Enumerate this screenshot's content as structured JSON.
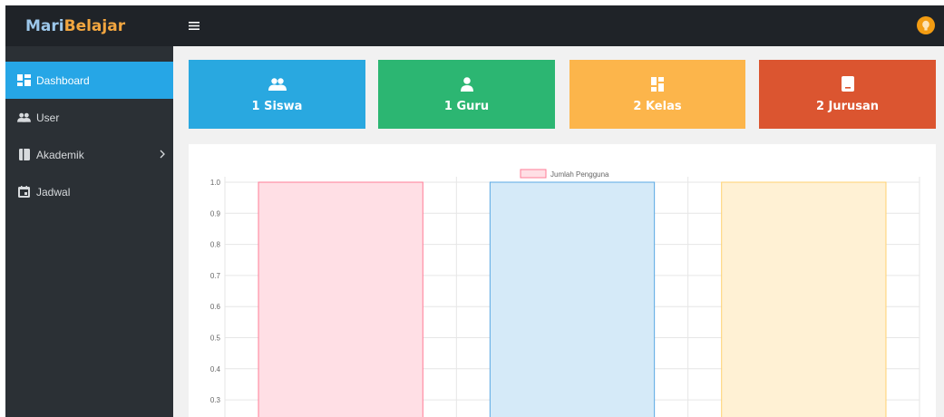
{
  "brand": {
    "part1": "Mari",
    "part2": "Belajar"
  },
  "sidebar": {
    "items": [
      {
        "label": "Dashboard",
        "icon": "dashboard-icon",
        "active": true
      },
      {
        "label": "User",
        "icon": "users-icon"
      },
      {
        "label": "Akademik",
        "icon": "book-icon",
        "has_submenu": true
      },
      {
        "label": "Jadwal",
        "icon": "calendar-icon"
      }
    ]
  },
  "topbar": {
    "menu_icon": "hamburger-icon",
    "avatar_icon": "user-avatar-icon"
  },
  "stats": [
    {
      "label": "1 Siswa",
      "icon": "users-icon",
      "color": "#29a8e0"
    },
    {
      "label": "1 Guru",
      "icon": "user-icon",
      "color": "#2cb672"
    },
    {
      "label": "2 Kelas",
      "icon": "dashboard-icon",
      "color": "#fcb54b"
    },
    {
      "label": "2 Jurusan",
      "icon": "book-icon",
      "color": "#db5530"
    }
  ],
  "chart_data": {
    "type": "bar",
    "legend": "Jumlah Pengguna",
    "legend_placement": "top-center",
    "categories": [
      "",
      "",
      ""
    ],
    "values": [
      1.0,
      1.0,
      1.0
    ],
    "colors": [
      {
        "fill": "#ffdfe5",
        "stroke": "#ff7c97"
      },
      {
        "fill": "#d5eaf8",
        "stroke": "#5aa9e3"
      },
      {
        "fill": "#fff1d4",
        "stroke": "#ffd170"
      }
    ],
    "ylim": [
      0.3,
      1.0
    ],
    "yticks": [
      "1.0",
      "0.9",
      "0.8",
      "0.7",
      "0.6",
      "0.5",
      "0.4",
      "0.3"
    ],
    "grid": true
  }
}
